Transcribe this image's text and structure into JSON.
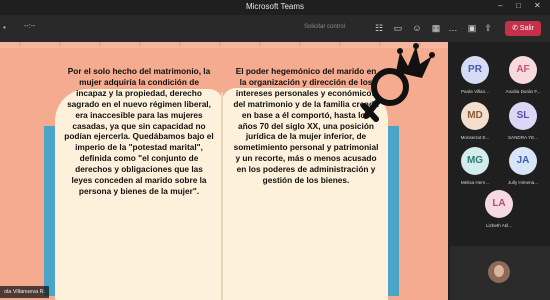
{
  "window": {
    "title": "Microsoft Teams"
  },
  "toolbar": {
    "more_label": "•••",
    "timer": "--:--",
    "request_control": "Solicitar control",
    "leave_label": "Salir"
  },
  "slide": {
    "left_text": "Por el solo hecho del matrimonio, la mujer adquiría la condición de incapaz y la propiedad, derecho sagrado en el nuevo régimen liberal, era inaccesible para las mujeres casadas, ya que sin capacidad no podían ejercerla. Quedábamos bajo el imperio de la \"potestad marital\", definida como \"el conjunto de derechos y obligaciones que las leyes conceden al marido sobre la persona y bienes de la mujer\".",
    "right_text": "El poder hegemónico del marido en la organización y dirección de los intereses personales y económicos del matrimonio y de la familia creada en base a él comportó, hasta los años 70 del siglo XX, una posición jurídica de la mujer inferior, de sometimiento personal y patrimonial y un recorte, más o menos acusado en los poderes de administración y gestión de los bienes."
  },
  "presenter_tag": "ola Villanueva R.",
  "participants": [
    {
      "initials": "PR",
      "name": "Paola Villan...",
      "bg": "#d6dcf5",
      "fg": "#4d5aa6"
    },
    {
      "initials": "AF",
      "name": "Analiia Durán F...",
      "bg": "#f7d9de",
      "fg": "#c4566a"
    },
    {
      "initials": "MD",
      "name": "Monserrat E...",
      "bg": "#f3dfce",
      "fg": "#8c5a3a"
    },
    {
      "initials": "SL",
      "name": "SANDRA YE...",
      "bg": "#dcd7f5",
      "fg": "#5a4fa6"
    },
    {
      "initials": "MG",
      "name": "Melisa Hern...",
      "bg": "#d3ecec",
      "fg": "#2e7a7a"
    },
    {
      "initials": "JA",
      "name": "Jully Himena...",
      "bg": "#d8e4f7",
      "fg": "#3f62a6"
    },
    {
      "initials": "LA",
      "name": "Lizbeth Atil...",
      "bg": "#f7d9e4",
      "fg": "#b34f74"
    }
  ],
  "colors": {
    "leave": "#c4314b",
    "slide_bg": "#f4ab90",
    "page": "#fdf1db",
    "book_edge": "#4aa5c8"
  },
  "icons": [
    "more-icon",
    "participants-icon",
    "chat-icon",
    "react-icon",
    "rooms-icon",
    "camera-icon",
    "mic-icon",
    "share-icon",
    "phone-icon",
    "minimize-icon",
    "maximize-icon",
    "close-icon",
    "mic-muted-icon",
    "female-symbol-crown-icon"
  ]
}
